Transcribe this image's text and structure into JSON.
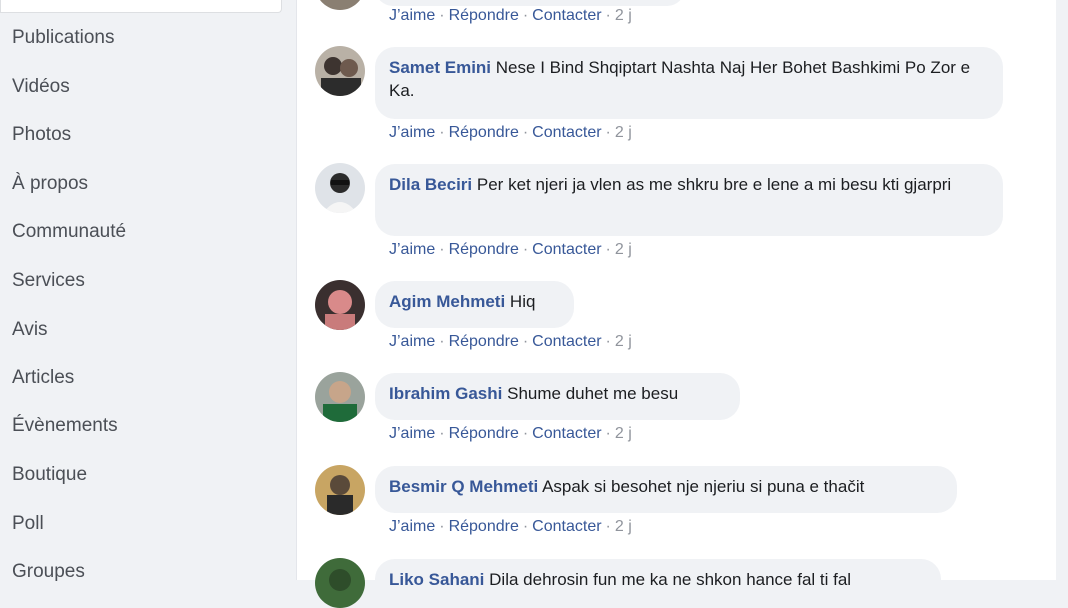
{
  "nav": {
    "items": [
      {
        "label": "Publications"
      },
      {
        "label": "Vidéos"
      },
      {
        "label": "Photos"
      },
      {
        "label": "À propos"
      },
      {
        "label": "Communauté"
      },
      {
        "label": "Services"
      },
      {
        "label": "Avis"
      },
      {
        "label": "Articles"
      },
      {
        "label": "Évènements"
      },
      {
        "label": "Boutique"
      },
      {
        "label": "Poll"
      },
      {
        "label": "Groupes"
      }
    ]
  },
  "actions": {
    "like": "J’aime",
    "reply": "Répondre",
    "contact": "Contacter",
    "sep": "·"
  },
  "comments": [
    {
      "time": "2 j"
    },
    {
      "author": "Samet Emini",
      "text": "Nese I Bind Shqiptart Nashta Naj Her Bohet Bashkimi Po Zor e Ka.",
      "time": "2 j"
    },
    {
      "author": "Dila Beciri",
      "text": "Per ket njeri ja vlen as me shkru bre e lene a mi besu kti gjarpri",
      "time": "2 j"
    },
    {
      "author": "Agim Mehmeti",
      "text": "Hiq",
      "time": "2 j"
    },
    {
      "author": "Ibrahim Gashi",
      "text": "Shume duhet me besu",
      "time": "2 j"
    },
    {
      "author": "Besmir Q Mehmeti",
      "text": "Aspak si besohet nje njeriu si puna e thačit",
      "time": "2 j"
    },
    {
      "author": "Liko Sahani",
      "text": "Dila dehrosin fun me ka ne shkon hance fal ti fal"
    }
  ]
}
